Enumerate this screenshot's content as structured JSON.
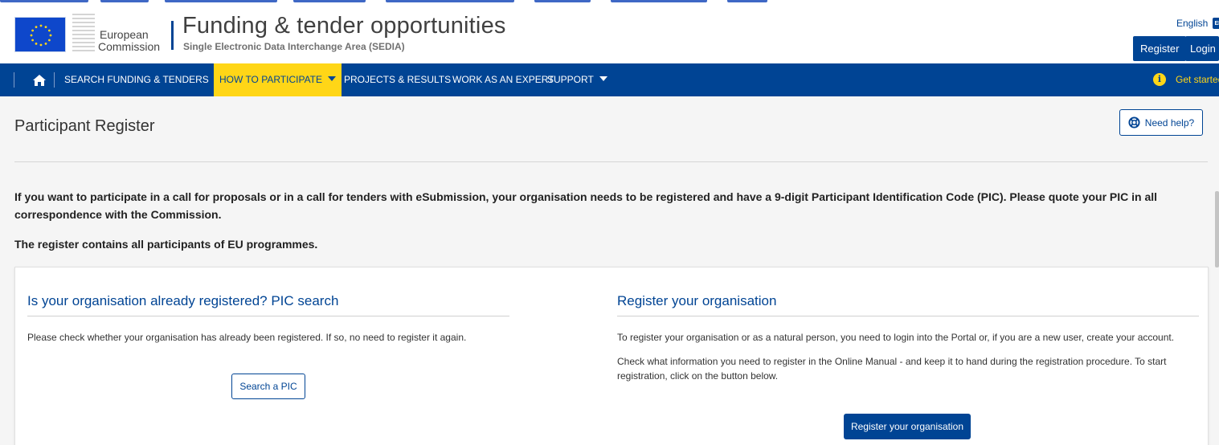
{
  "header": {
    "ec_line1": "European",
    "ec_line2": "Commission",
    "title": "Funding & tender opportunities",
    "subtitle": "Single Electronic Data Interchange Area (SEDIA)",
    "language": "English",
    "language_badge": "EN",
    "register_label": "Register",
    "login_label": "Login"
  },
  "nav": {
    "home_icon": "home-icon",
    "items": [
      {
        "label": "SEARCH FUNDING & TENDERS",
        "dropdown": true
      },
      {
        "label": "HOW TO PARTICIPATE",
        "dropdown": true,
        "active": true
      },
      {
        "label": "PROJECTS & RESULTS"
      },
      {
        "label": "WORK AS AN EXPERT"
      },
      {
        "label": "SUPPORT",
        "dropdown": true
      }
    ],
    "get_started": "Get started",
    "info_icon": "info-icon"
  },
  "page": {
    "title": "Participant Register",
    "need_help": "Need help?",
    "intro": "If you want to participate in a call for proposals or in a call for tenders with eSubmission, your organisation needs to be registered and have a 9-digit Participant Identification Code (PIC). Please quote your PIC in all correspondence with the Commission.",
    "intro2": "The register contains all participants of EU programmes."
  },
  "search_col": {
    "title": "Is your organisation already registered? PIC search",
    "text": "Please check whether your organisation has already been registered. If so, no need to register it again.",
    "button": "Search a PIC"
  },
  "register_col": {
    "title": "Register your organisation",
    "text1": "To register your organisation or as a natural person, you need to login into the Portal or, if you are a new user, create your account.",
    "text2": "Check what information you need to register in the Online Manual - and keep it to hand during the registration procedure. To start registration, click on the button below.",
    "button": "Register your organisation"
  },
  "colors": {
    "brand_blue": "#004494",
    "active_yellow": "#ffd617"
  }
}
